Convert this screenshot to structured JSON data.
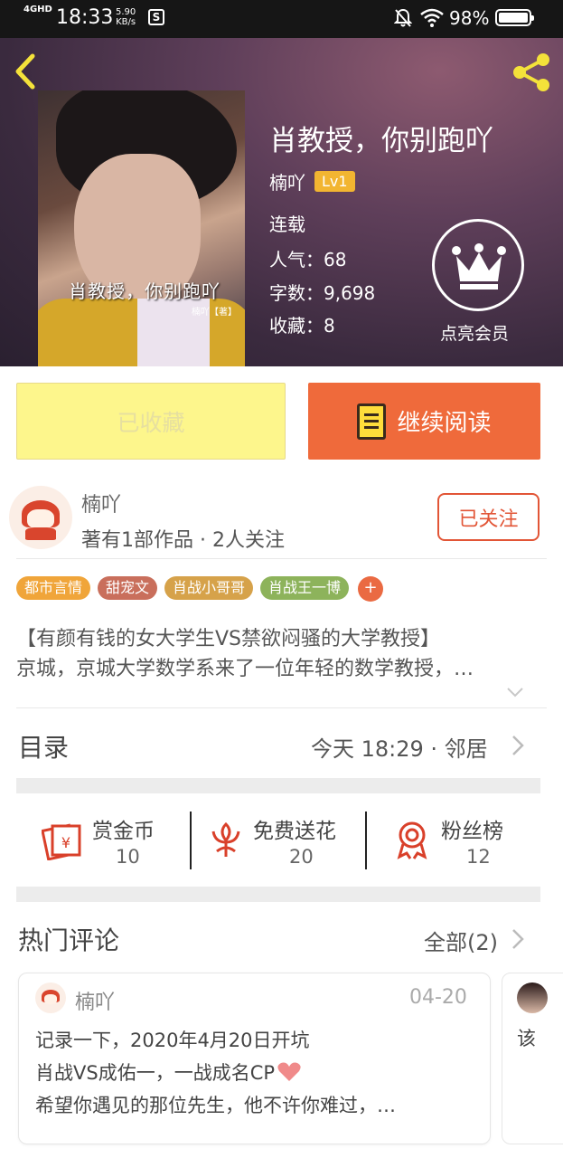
{
  "status_bar": {
    "network": "4GHD",
    "time": "18:33",
    "speed_value": "5.90",
    "speed_unit": "KB/s",
    "battery": "98%"
  },
  "book": {
    "title": "肖教授，你别跑吖",
    "cover_title": "肖教授，你别跑吖",
    "cover_author": "楠吖【著】",
    "author": "楠吖",
    "level": "Lv1",
    "status": "连载",
    "popularity": "人气：68",
    "word_count": "字数：9,698",
    "favorites": "收藏：8",
    "vip_label": "点亮会员"
  },
  "actions": {
    "collected_label": "已收藏",
    "read_label": "继续阅读"
  },
  "author_section": {
    "name": "楠吖",
    "info": "著有1部作品 · 2人关注",
    "follow_label": "已关注"
  },
  "tags": [
    {
      "label": "都市言情",
      "color": "#f0a53a"
    },
    {
      "label": "甜宠文",
      "color": "#c96f5c"
    },
    {
      "label": "肖战小哥哥",
      "color": "#d6a24a"
    },
    {
      "label": "肖战王一博",
      "color": "#8db35b"
    }
  ],
  "tag_add": "+",
  "intro": {
    "line1": "【有颜有钱的女大学生VS禁欲闷骚的大学教授】",
    "line2": "京城，京城大学数学系来了一位年轻的数学教授，…"
  },
  "toc": {
    "label": "目录",
    "update": "今天 18:29 · 邻居"
  },
  "stats": [
    {
      "label": "赏金币",
      "value": "10",
      "icon": "red-envelope-icon"
    },
    {
      "label": "免费送花",
      "value": "20",
      "icon": "flower-icon"
    },
    {
      "label": "粉丝榜",
      "value": "12",
      "icon": "medal-icon"
    }
  ],
  "comments_section": {
    "label": "热门评论",
    "all_label": "全部(2)"
  },
  "comment": {
    "user": "楠吖",
    "date": "04-20",
    "line1": "记录一下，2020年4月20日开坑",
    "line2": "肖战VS成佑一，一战成名CP",
    "line3": "希望你遇见的那位先生，他不许你难过，…"
  },
  "comment2_preview": "该",
  "colors": {
    "accent": "#ef6a3b",
    "follow": "#e25536",
    "collected_bg": "#fdf68c",
    "level_badge": "#f2b531"
  }
}
